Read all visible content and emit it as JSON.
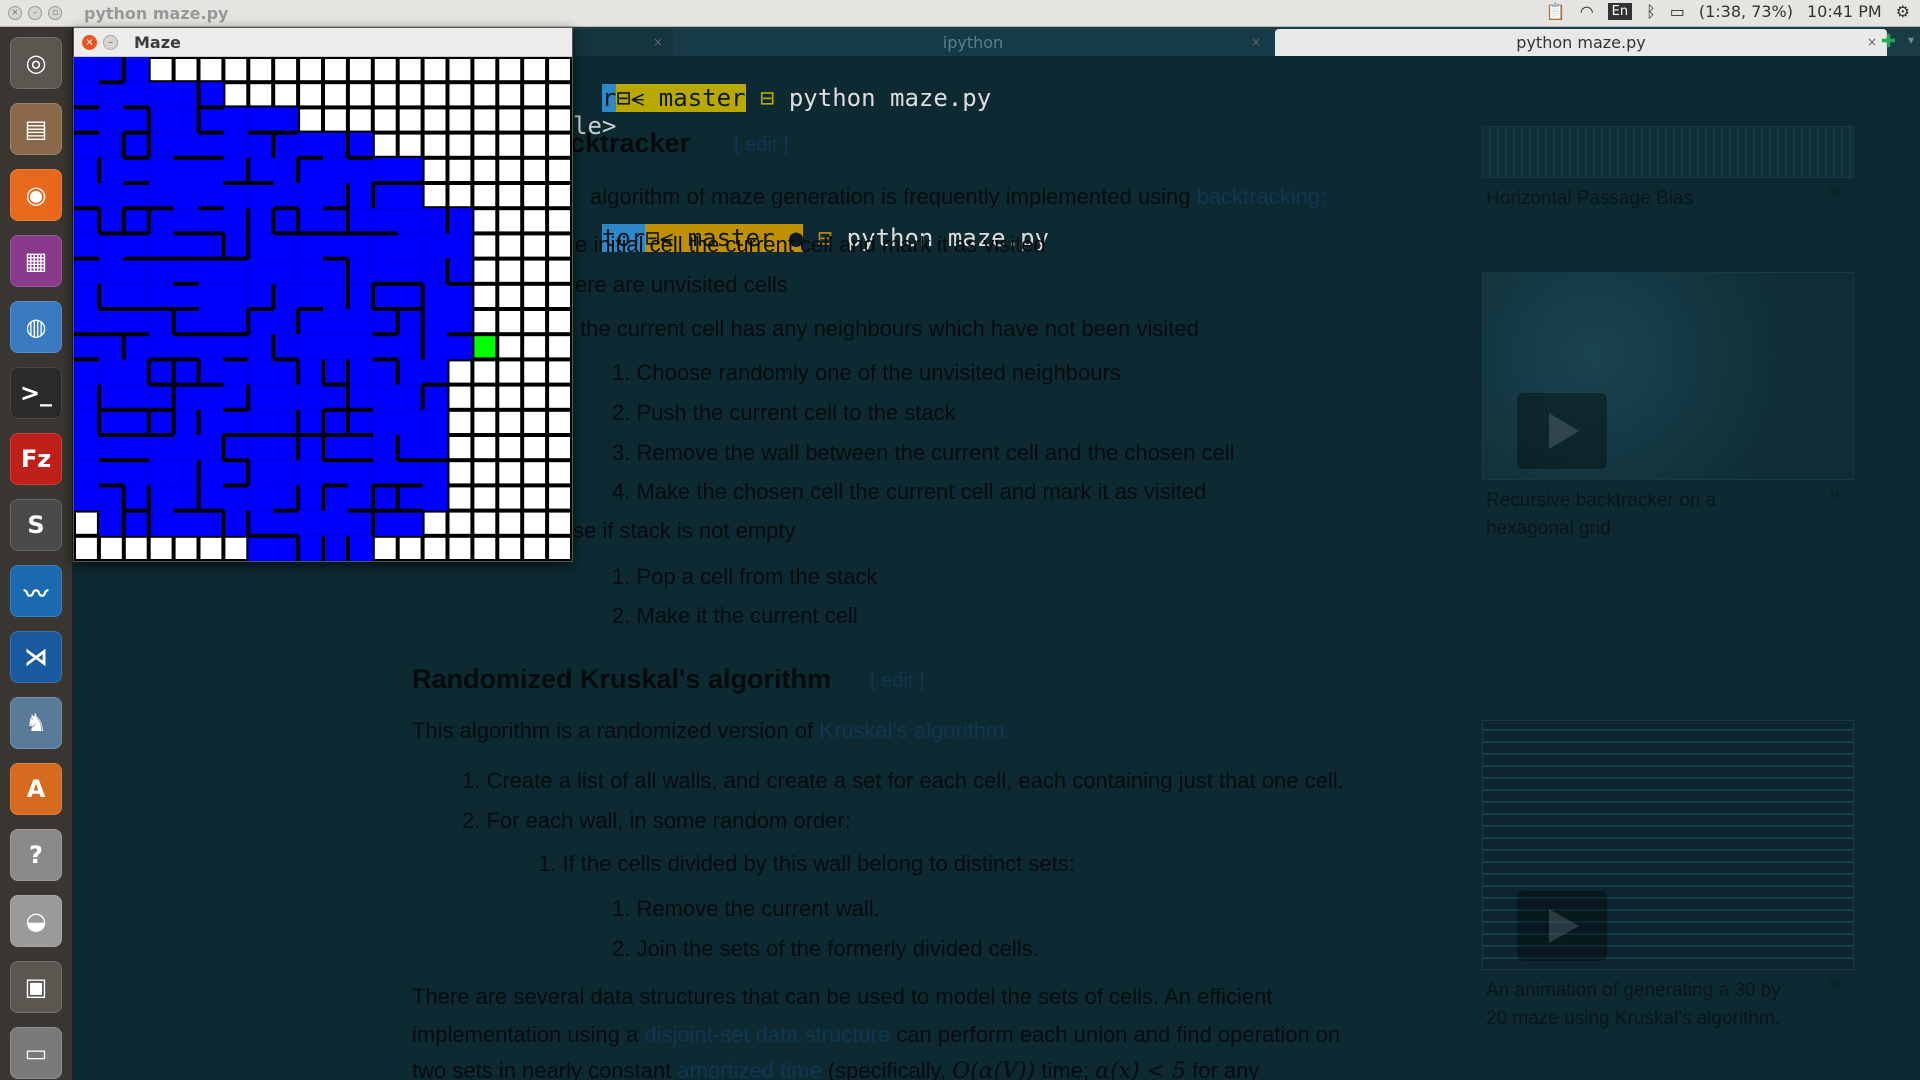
{
  "panel": {
    "title": "python maze.py",
    "keyboard": "En",
    "battery": "(1:38, 73%)",
    "clock": "10:41 PM"
  },
  "launcher": {
    "items": [
      {
        "name": "dash-home-icon",
        "color": "#5a5650",
        "glyph": "◎"
      },
      {
        "name": "files-icon",
        "color": "#8a6a4a",
        "glyph": "▤"
      },
      {
        "name": "firefox-icon",
        "color": "#e8681e",
        "glyph": "◉"
      },
      {
        "name": "media-player-icon",
        "color": "#8a3a8a",
        "glyph": "▦"
      },
      {
        "name": "chromium-icon",
        "color": "#3a7ac0",
        "glyph": "◍"
      },
      {
        "name": "terminal-icon",
        "color": "#2a2a2a",
        "glyph": ">_"
      },
      {
        "name": "filezilla-icon",
        "color": "#c0201a",
        "glyph": "Fz"
      },
      {
        "name": "sublime-text-icon",
        "color": "#4a4a4a",
        "glyph": "S"
      },
      {
        "name": "system-monitor-icon",
        "color": "#1a6ab0",
        "glyph": "〰"
      },
      {
        "name": "vscode-icon",
        "color": "#1a5aa0",
        "glyph": "⋊"
      },
      {
        "name": "pgadmin-icon",
        "color": "#5a7a9a",
        "glyph": "♞"
      },
      {
        "name": "software-center-icon",
        "color": "#d86a20",
        "glyph": "A"
      },
      {
        "name": "help-icon",
        "color": "#8a8a8a",
        "glyph": "?"
      },
      {
        "name": "disk-icon",
        "color": "#9a9a9a",
        "glyph": "◒"
      },
      {
        "name": "workspace-switcher-icon",
        "color": "#5a5650",
        "glyph": "▣"
      },
      {
        "name": "trash-icon",
        "color": "#7a7a7a",
        "glyph": "▭"
      }
    ]
  },
  "browser": {
    "tabs": [
      {
        "label": "ipython"
      },
      {
        "label": "python maze.py"
      }
    ]
  },
  "terminal": {
    "line1": {
      "seg1": "r",
      "sep": "⊟",
      "branch": "⪪ master",
      "cmd": "python maze.py"
    },
    "line2": {
      "text": "le>"
    },
    "line3": {
      "seg1": "tor",
      "sep": "⊟",
      "branch": "⪪ master ●",
      "cmd": "python maze.py"
    }
  },
  "article": {
    "section1_title": "cktracker",
    "edit1": "[ edit ]",
    "intro": "algorithm of maze generation is frequently implemented using",
    "intro_link": "backtracking:",
    "s1": "e initial cell the current cell and mark it as visited",
    "s2": "ere are unvisited cells",
    "s3": "the current cell has any neighbours which have not been visited",
    "s3_items": [
      "1. Choose randomly one of the unvisited neighbours",
      "2. Push the current cell to the stack",
      "3. Remove the wall between the current cell and the chosen cell",
      "4. Make the chosen cell the current cell and mark it as visited"
    ],
    "s4": "se if stack is not empty",
    "s4_items": [
      "1. Pop a cell from the stack",
      "2. Make it the current cell"
    ],
    "section2_title": "Randomized Kruskal's algorithm",
    "edit2": "[ edit ]",
    "k_intro": "This algorithm is a randomized version of",
    "k_intro_link": "Kruskal's algorithm.",
    "k_items": [
      "1. Create a list of all walls, and create a set for each cell, each containing just that one cell.",
      "2. For each wall, in some random order:"
    ],
    "k_sub": "1. If the cells divided by this wall belong to distinct sets:",
    "k_subsub": [
      "1. Remove the current wall.",
      "2. Join the sets of the formerly divided cells."
    ],
    "para1": "There are several data structures that can be used to model the sets of cells. An efficient",
    "para2a": "implementation using a",
    "para2_link": "disjoint-set data structure",
    "para2b": "can perform each union and find operation on",
    "para3a": "two sets in nearly constant",
    "para3_link": "amortized time",
    "para3b": "(specifically,",
    "para3_math": "O(α(V))",
    "para3c": "time;",
    "para3_math2": "α(x) < 5",
    "para3d": "for any"
  },
  "sidebar": {
    "cap1": "Horizontal Passage Bias",
    "cap2a": "Recursive backtracker on a",
    "cap2b": "hexagonal grid",
    "cap3a": "An animation of generating a 30 by",
    "cap3b": "20 maze using Kruskal's algorithm."
  },
  "maze_window": {
    "title": "Maze",
    "grid_cols": 20,
    "grid_rows": 20,
    "colors": {
      "path": "#0000ff",
      "unvisited": "#ffffff",
      "current": "#00ff00",
      "wall": "#000000"
    },
    "cells": [
      "BBBWWWWWWWWWWWWWWWWW",
      "BBBBBBWWWWWWWWWWWWWW",
      "BBBBBBBBBWWWWWWWWWWW",
      "BBBBBBBBBBBBWWWWWWWW",
      "BBBBBBBBBBBBBBWWWWWW",
      "BBBBBBBBBBBBBBWWWWWW",
      "BBBBBBBBBBBBBBBBWWWW",
      "BBBBBBBBBBBBBBBBWWWW",
      "BBBBBBBBBBBBBBBBWWWW",
      "BBBBBBBBBBBBBBBBWWWW",
      "BBBBBBBBBBBBBBBBWWWW",
      "BBBBBBBBBBBBBBBBGWWW",
      "BBBBBBBBBBBBBBBWWWWW",
      "BBBBBBBBBBBBBBBWWWWW",
      "BBBBBBBBBBBBBBBWWWWW",
      "BBBBBBBBBBBBBBBWWWWW",
      "BBBBBBBBBBBBBBBWWWWW",
      "BBBBBBBBBBBBBBBWWWWW",
      "WBBBBBBBBBBBBBWWWWWW",
      "WWWWWWWBBBBBWWWWWWWW"
    ]
  }
}
